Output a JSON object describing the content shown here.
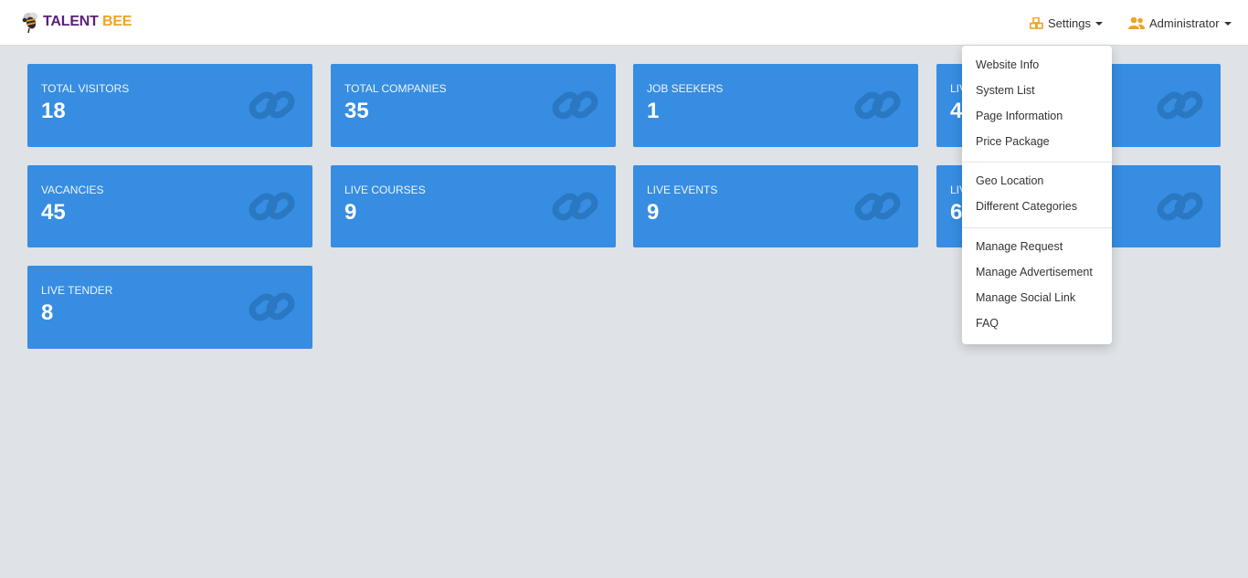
{
  "brand": {
    "part1": "TALENT",
    "part2": "BEE",
    "color1": "#5a1f78",
    "color2": "#f0a225"
  },
  "nav": {
    "settings_label": "Settings",
    "admin_label": "Administrator",
    "icon_color": "#f0a225"
  },
  "cards": [
    {
      "label": "TOTAL VISITORS",
      "value": "18"
    },
    {
      "label": "TOTAL COMPANIES",
      "value": "35"
    },
    {
      "label": "JOB SEEKERS",
      "value": "1"
    },
    {
      "label": "LIV",
      "value": "4"
    },
    {
      "label": "VACANCIES",
      "value": "45"
    },
    {
      "label": "LIVE COURSES",
      "value": "9"
    },
    {
      "label": "LIVE EVENTS",
      "value": "9"
    },
    {
      "label": "LIV",
      "value": "6"
    },
    {
      "label": "LIVE TENDER",
      "value": "8"
    }
  ],
  "card_icon": "link-icon",
  "card_color": "#368de1",
  "settings_menu": {
    "group1": [
      "Website Info",
      "System List",
      "Page Information",
      "Price Package"
    ],
    "group2": [
      "Geo Location",
      "Different Categories"
    ],
    "group3": [
      "Manage Request",
      "Manage Advertisement",
      "Manage Social Link",
      "FAQ"
    ]
  }
}
